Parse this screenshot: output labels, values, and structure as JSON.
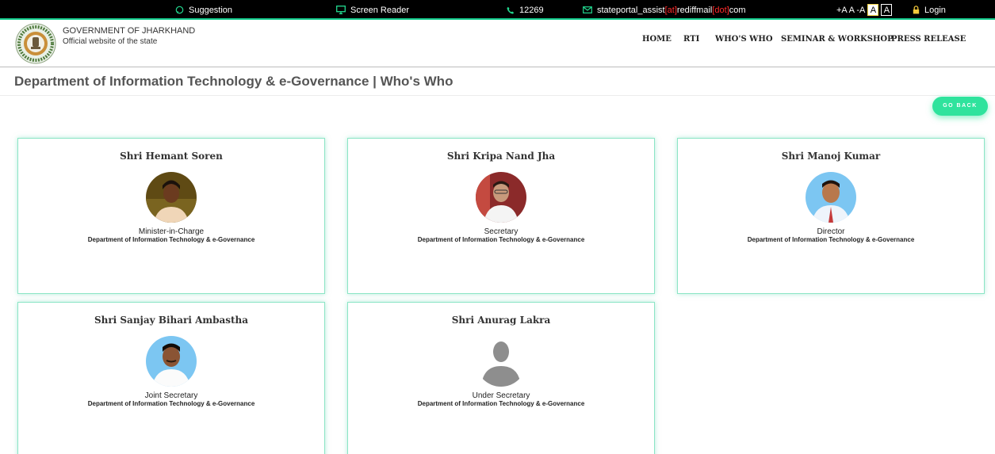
{
  "topbar": {
    "suggestion": "Suggestion",
    "screen_reader": "Screen Reader",
    "phone": "12269",
    "email_user": "stateportal_assist ",
    "email_at": "[at]",
    "email_domain": "rediffmail",
    "email_dot": "[dot]",
    "email_tld": "com",
    "font_controls": "+A A -A",
    "contrast_light": "A",
    "contrast_dark": "A",
    "login": "Login"
  },
  "header": {
    "org_title": "GOVERNMENT OF JHARKHAND",
    "org_subtitle": "Official website of the state",
    "nav": [
      "HOME",
      "RTI",
      "WHO'S WHO",
      "SEMINAR & WORKSHOP",
      "PRESS RELEASE"
    ]
  },
  "page": {
    "title": "Department of Information Technology & e-Governance | Who's Who",
    "go_back": "GO BACK"
  },
  "cards": [
    {
      "name": "Shri Hemant Soren",
      "role": "Minister-in-Charge",
      "department": "Department of Information Technology & e-Governance"
    },
    {
      "name": "Shri Kripa Nand Jha",
      "role": "Secretary",
      "department": "Department of Information Technology & e-Governance"
    },
    {
      "name": "Shri Manoj Kumar",
      "role": "Director",
      "department": "Department of Information Technology & e-Governance"
    },
    {
      "name": "Shri Sanjay Bihari Ambastha",
      "role": "Joint Secretary",
      "department": "Department of Information Technology & e-Governance"
    },
    {
      "name": "Shri Anurag Lakra",
      "role": "Under Secretary",
      "department": "Department of Information Technology & e-Governance"
    }
  ],
  "colors": {
    "accent": "#2fe39d",
    "topbar_bg": "#000000",
    "card_border": "#8be5c5",
    "title_text": "#555555"
  }
}
